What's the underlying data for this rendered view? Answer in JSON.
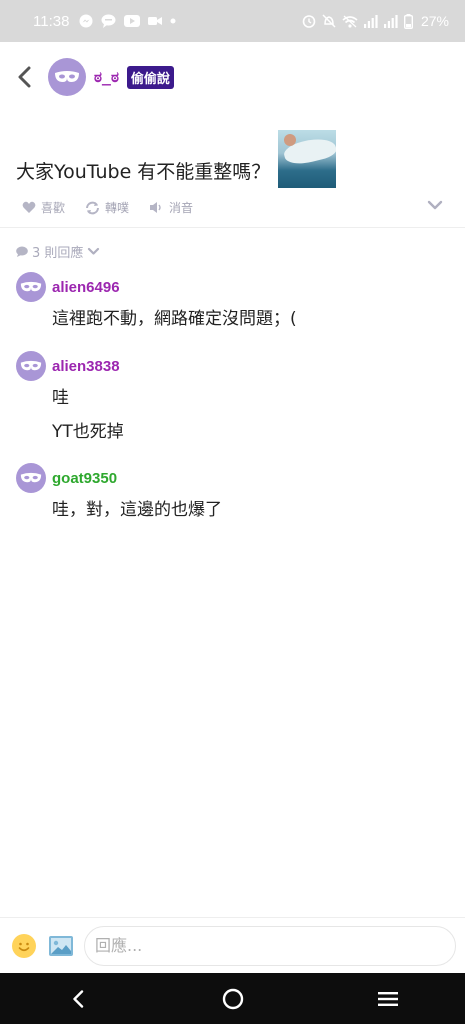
{
  "status_bar": {
    "time": "11:38",
    "battery": "27%",
    "left_icons": [
      "messenger-icon",
      "chat-icon",
      "youtube-icon",
      "video-icon",
      "dot-icon"
    ],
    "right_icons": [
      "alarm-icon",
      "mute-icon",
      "wifi-icon",
      "signal-icon",
      "signal-icon",
      "battery-icon"
    ]
  },
  "header": {
    "author": "ಠ_ಠ",
    "board": "偷偷說"
  },
  "post": {
    "text": "大家YouTube 有不能重整嗎？",
    "actions": {
      "like": "喜歡",
      "repost": "轉噗",
      "mute": "消音"
    }
  },
  "replies": {
    "count_label": "3 則回應",
    "items": [
      {
        "author": "alien6496",
        "author_color": "#9c27b0",
        "lines": [
          "這裡跑不動，網路確定沒問題；("
        ]
      },
      {
        "author": "alien3838",
        "author_color": "#9c27b0",
        "lines": [
          "哇",
          "YT也死掉"
        ]
      },
      {
        "author": "goat9350",
        "author_color": "#2ea82e",
        "lines": [
          "哇，對，這邊的也爆了"
        ]
      }
    ]
  },
  "input": {
    "placeholder": "回應..."
  },
  "colors": {
    "accent_purple": "#9c27b0",
    "badge_bg": "#3c1a8c",
    "avatar_bg": "#a996d6",
    "green_author": "#2ea82e"
  }
}
